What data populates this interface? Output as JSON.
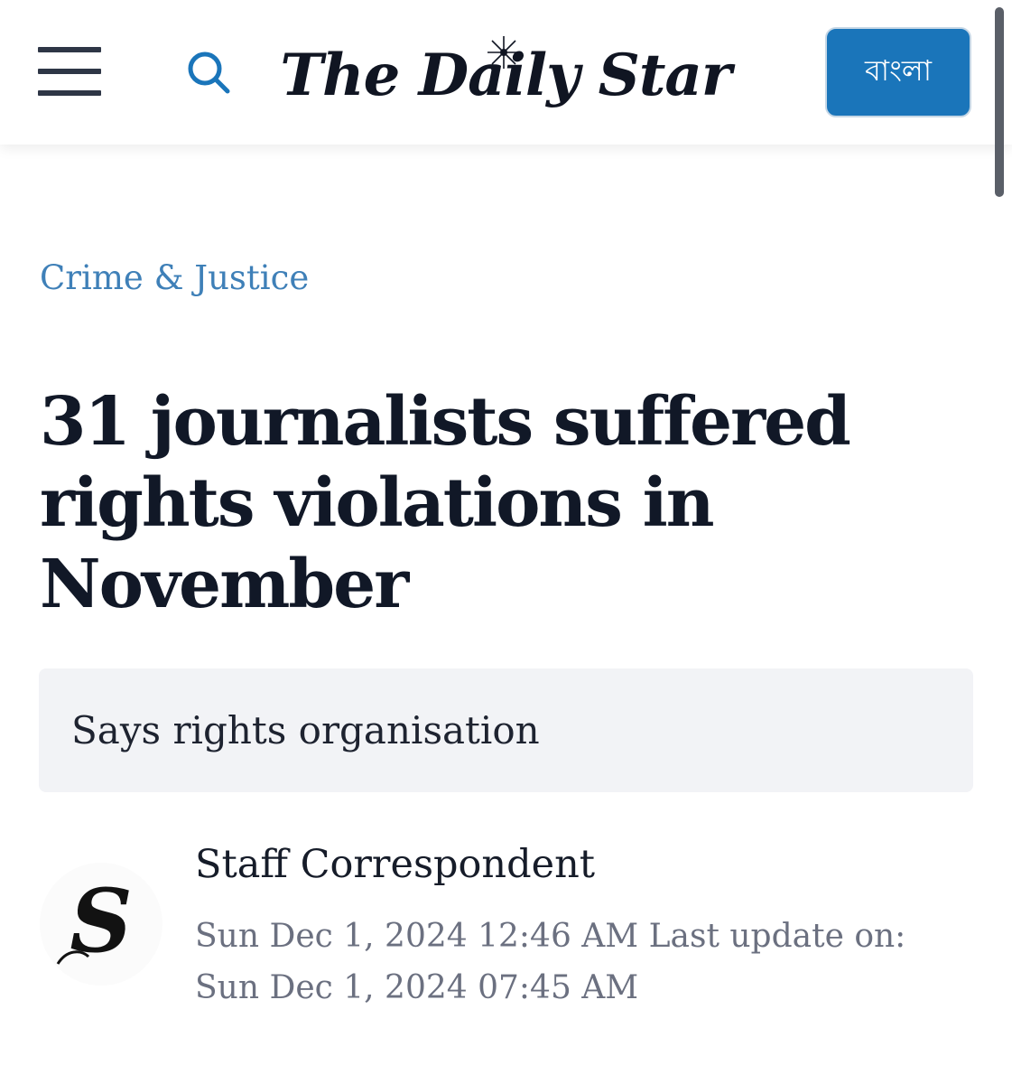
{
  "header": {
    "menu_icon": "hamburger-menu-icon",
    "search_icon": "search-icon",
    "logo_text": "The Daily Star",
    "language_button": "বাংলা",
    "accent_color": "#1a75ba"
  },
  "article": {
    "category": "Crime & Justice",
    "headline": "31 journalists suffered rights violations in November",
    "subtitle": "Says rights organisation",
    "author": {
      "name": "Staff Correspondent",
      "avatar_icon": "daily-star-s-logo-icon"
    },
    "published_text": "Sun Dec 1, 2024 12:46 AM",
    "update_label": "Last update on:",
    "updated_text": "Sun Dec 1, 2024 07:45 AM"
  }
}
